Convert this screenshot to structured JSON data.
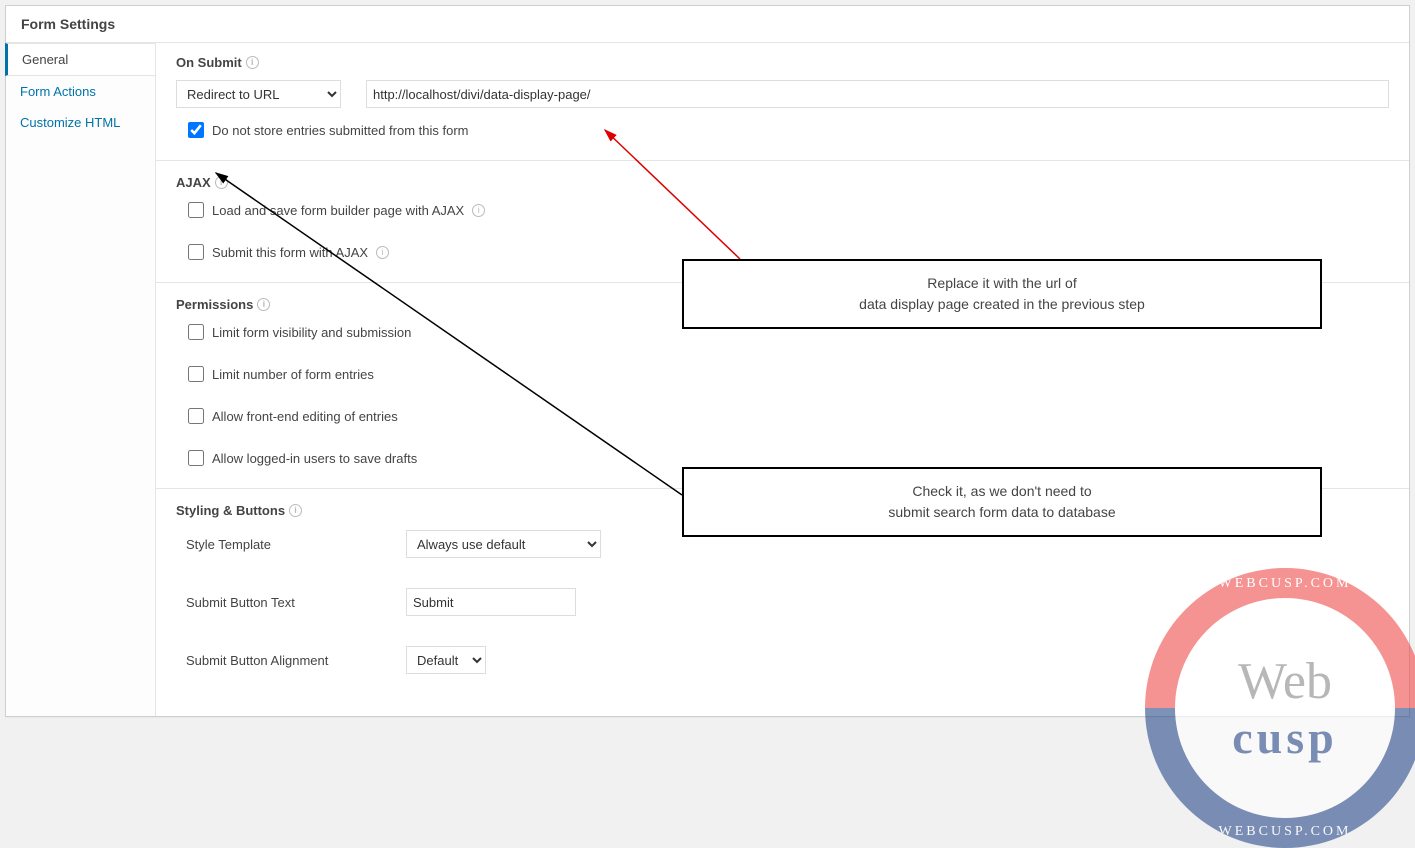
{
  "panel": {
    "title": "Form Settings"
  },
  "tabs": {
    "general": "General",
    "form_actions": "Form Actions",
    "customize_html": "Customize HTML"
  },
  "on_submit": {
    "title": "On Submit",
    "select_value": "Redirect to URL",
    "url_value": "http://localhost/divi/data-display-page/",
    "no_store_label": "Do not store entries submitted from this form",
    "no_store_checked": true
  },
  "ajax": {
    "title": "AJAX",
    "load_label": "Load and save form builder page with AJAX",
    "submit_label": "Submit this form with AJAX"
  },
  "permissions": {
    "title": "Permissions",
    "limit_visibility": "Limit form visibility and submission",
    "limit_entries": "Limit number of form entries",
    "frontend_edit": "Allow front-end editing of entries",
    "save_drafts": "Allow logged-in users to save drafts"
  },
  "styling": {
    "title": "Styling & Buttons",
    "style_template_label": "Style Template",
    "style_template_value": "Always use default",
    "submit_text_label": "Submit Button Text",
    "submit_text_value": "Submit",
    "submit_align_label": "Submit Button Alignment",
    "submit_align_value": "Default"
  },
  "annotations": {
    "callout1": "Replace it with the url of\ndata display page created in the previous step",
    "callout2": "Check it, as we don't need to\nsubmit search form data to database"
  },
  "watermark": {
    "brand_top": "Web",
    "brand_bottom": "cusp",
    "arc": "WEBCUSP.COM"
  }
}
